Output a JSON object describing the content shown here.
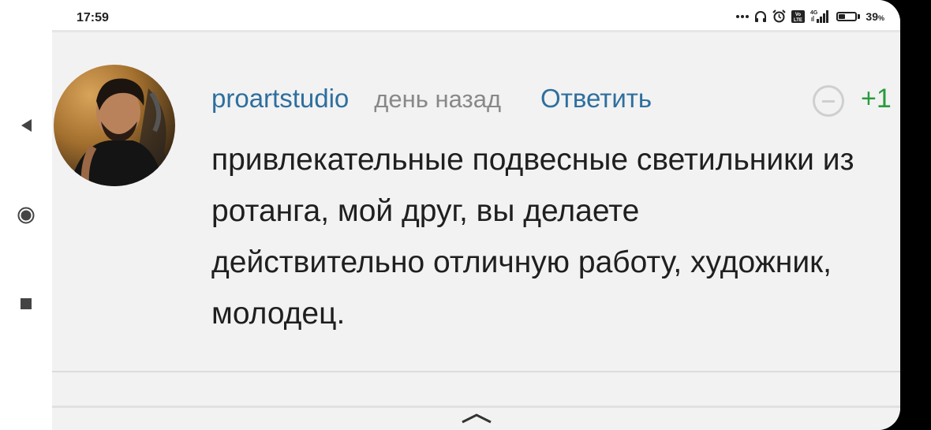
{
  "status_bar": {
    "time": "17:59",
    "icons": [
      "more-dots-icon",
      "headphones-icon",
      "alarm-icon",
      "volte-icon",
      "signal-4g-icon",
      "battery-icon"
    ],
    "network": "4G",
    "battery_level": 0.39,
    "battery_percent": "39",
    "battery_percent_sign": "%"
  },
  "nav_bar": {
    "buttons": [
      "back-icon",
      "home-icon",
      "recents-icon"
    ]
  },
  "comment": {
    "username": "proartstudio",
    "time_ago": "день назад",
    "reply_label": "Ответить",
    "score": "+1",
    "text": "привлекательные подвесные светильники из ротанга, мой друг, вы делаете действительно отличную работу, художник, молодец."
  },
  "colors": {
    "link": "#2e6f9e",
    "score_positive": "#2a9b3c",
    "meta_gray": "#888888",
    "content_bg": "#f2f2f2"
  }
}
